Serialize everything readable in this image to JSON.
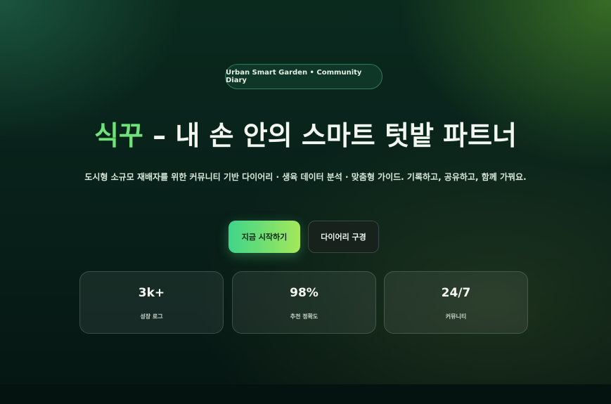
{
  "hero": {
    "badge": "Urban Smart Garden • Community Diary",
    "title_brand": "식꾸",
    "title_rest": " – 내 손 안의 스마트 텃밭 파트너",
    "subtitle": "도시형 소규모 재배자를 위한 커뮤니티 기반 다이어리 · 생육 데이터 분석 · 맞춤형 가이드. 기록하고, 공유하고, 함께 가꿔요."
  },
  "actions": {
    "primary_label": "지금 시작하기",
    "secondary_label": "다이어리 구경"
  },
  "stats": [
    {
      "value": "3k+",
      "label": "성장 로그"
    },
    {
      "value": "98%",
      "label": "추천 정확도"
    },
    {
      "value": "24/7",
      "label": "커뮤니티"
    }
  ],
  "colors": {
    "brand_green": "#6fe27a",
    "primary_gradient_start": "#3fd48a",
    "primary_gradient_end": "#a5e85a",
    "background": "#08211a"
  }
}
